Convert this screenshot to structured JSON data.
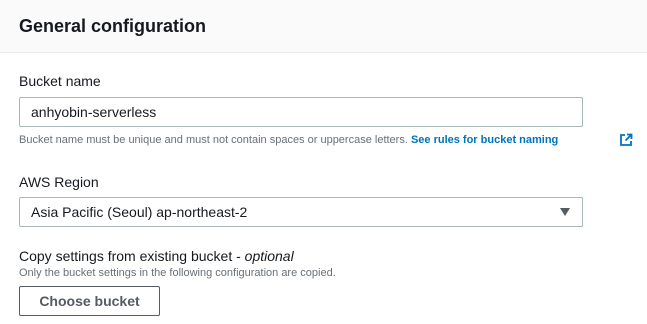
{
  "panel": {
    "title": "General configuration"
  },
  "bucket_name": {
    "label": "Bucket name",
    "value": "anhyobin-serverless",
    "hint": "Bucket name must be unique and must not contain spaces or uppercase letters.",
    "link": "See rules for bucket naming",
    "link_icon": "external-link-icon"
  },
  "region": {
    "label": "AWS Region",
    "value": "Asia Pacific (Seoul) ap-northeast-2",
    "caret_icon": "caret-down-icon"
  },
  "copy_settings": {
    "label": "Copy settings from existing bucket - ",
    "optional": "optional",
    "description": "Only the bucket settings in the following configuration are copied.",
    "button": "Choose bucket"
  }
}
